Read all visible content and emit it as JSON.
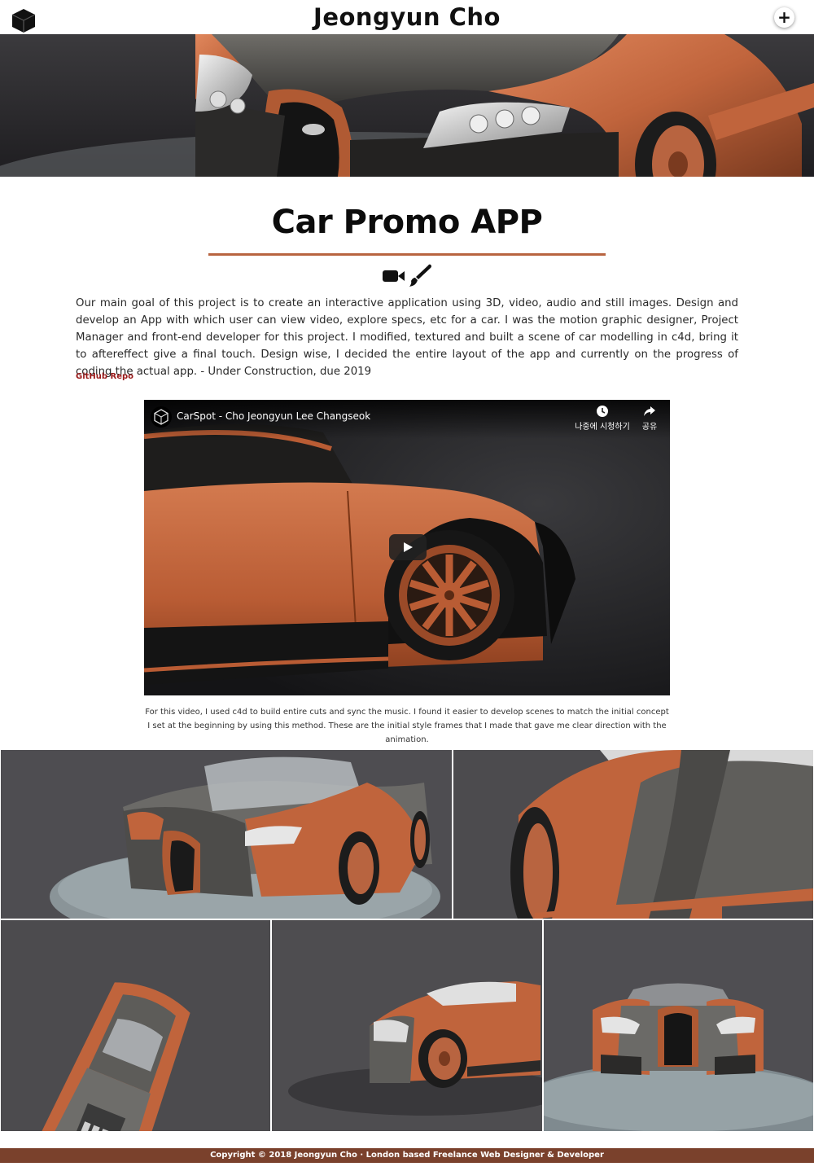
{
  "header": {
    "site_title": "Jeongyun Cho",
    "logo_icon": "cube-logo-icon",
    "menu_icon": "plus-icon",
    "menu_label": "+"
  },
  "hero": {
    "image": "orange-black-supercar-front-closeup"
  },
  "project": {
    "title": "Car Promo APP",
    "icons": [
      "video-camera-icon",
      "paintbrush-icon"
    ],
    "description": "Our main goal of this project is to create an interactive application using 3D, video, audio and still images. Design and develop an App with which user can view video, explore specs, etc for a car.  I was the motion graphic designer, Project Manager and front-end developer for this project. I modified, textured and built a scene of car modelling in c4d, bring it to aftereffect give a final touch. Design wise, I decided the entire layout of the app and currently on the progress of coding the actual app.  - Under Construction, due 2019",
    "repo_link": "GitHub Repo"
  },
  "video": {
    "title": "CarSpot - Cho Jeongyun Lee Changseok",
    "watch_later": "나중에 시청하기",
    "share": "공유",
    "caption": "For this video, I used c4d to build entire cuts and sync the music. I found it easier to develop scenes to match the initial concept I set at the beginning by using this method. These are the initial style frames that I made that gave me clear direction with the animation."
  },
  "gallery": {
    "images": [
      "car-three-quarter-front-on-turntable",
      "car-side-panel-closeup",
      "car-top-down-view",
      "car-low-angle-side",
      "car-front-view-on-turntable"
    ]
  },
  "colors": {
    "accent": "#b86440",
    "footer_bg": "#7a412c",
    "link": "#9a1a1a",
    "car_orange": "#c0643c"
  },
  "footer": {
    "text": "Copyright © 2018 Jeongyun Cho · London based Freelance Web Designer & Developer"
  }
}
